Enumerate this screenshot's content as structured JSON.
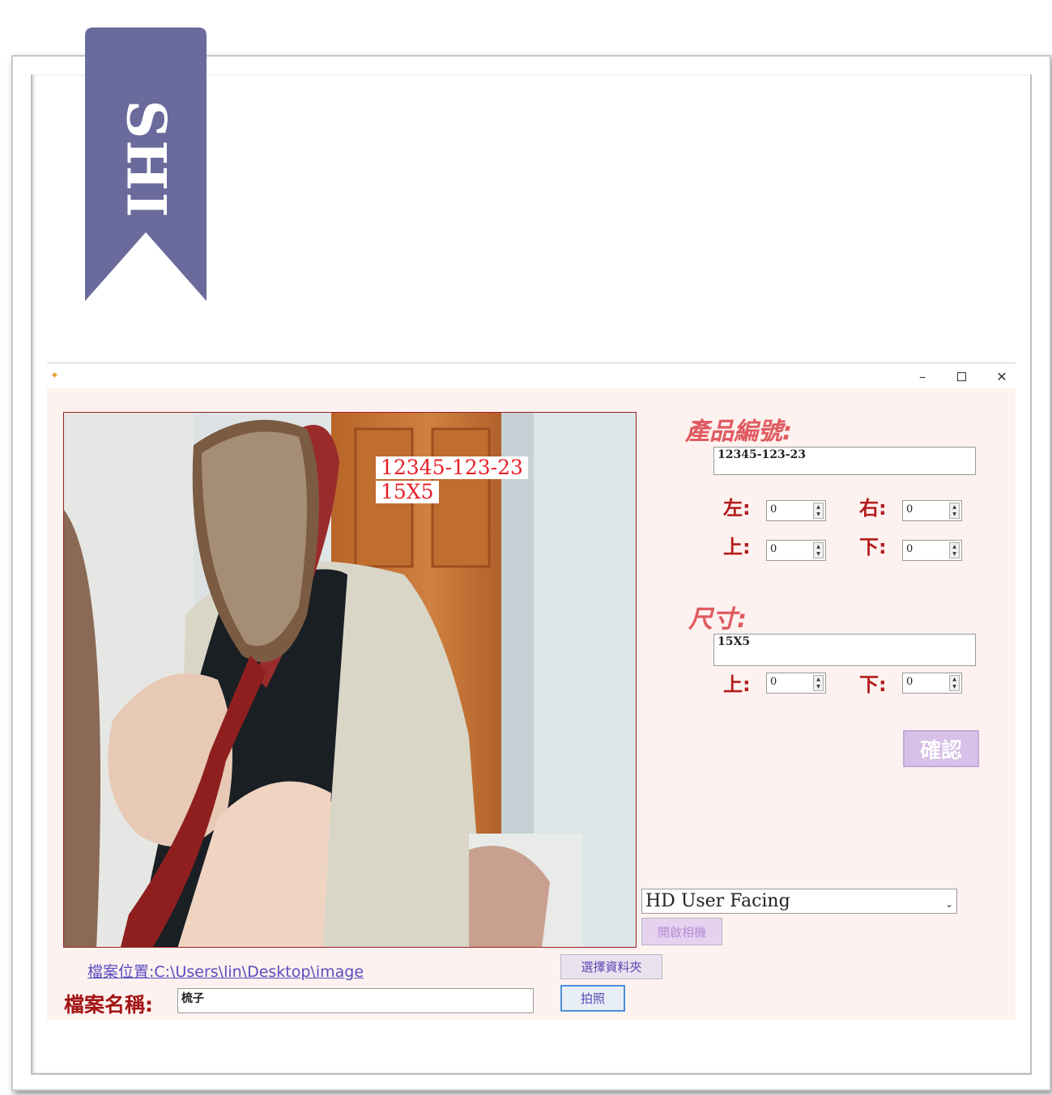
{
  "ribbon": {
    "text": "SHI",
    "color": "#6a6a9c"
  },
  "window": {
    "min_symbol": "–",
    "close_symbol": "✕"
  },
  "preview": {
    "overlay_code": "12345-123-23",
    "overlay_size": "15X5"
  },
  "product": {
    "title": "產品編號:",
    "code_value": "12345-123-23",
    "left_label": "左:",
    "left_value": "0",
    "right_label": "右:",
    "right_value": "0",
    "top_label": "上:",
    "top_value": "0",
    "bottom_label": "下:",
    "bottom_value": "0"
  },
  "size": {
    "title": "尺寸:",
    "size_value": "15X5",
    "top_label": "上:",
    "top_value": "0",
    "bottom_label": "下:",
    "bottom_value": "0"
  },
  "confirm_label": "確認",
  "camera": {
    "device": "HD User Facing",
    "open_label": "開啟相機"
  },
  "file": {
    "path_text": "檔案位置:C:\\Users\\lin\\Desktop\\image",
    "select_folder_label": "選擇資料夾",
    "name_label": "檔案名稱:",
    "name_value": "梳子",
    "shoot_label": "拍照"
  },
  "colors": {
    "accent_red": "#b31b1b",
    "title_pink": "#e05a60",
    "window_bg": "#fdf2ef",
    "button_purple": "#d8c0e8"
  }
}
